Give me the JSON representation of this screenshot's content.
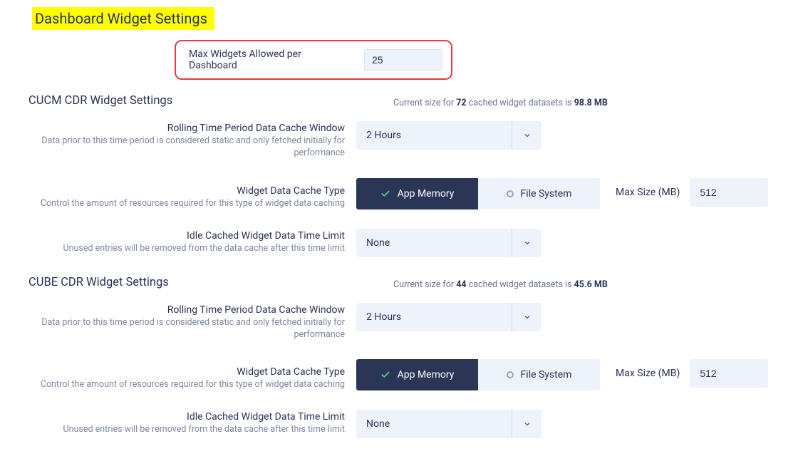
{
  "page_title": "Dashboard Widget Settings",
  "max_widgets": {
    "label": "Max Widgets Allowed per Dashboard",
    "value": "25"
  },
  "sections": {
    "cucm": {
      "title": "CUCM CDR Widget Settings",
      "cache_info_prefix": "Current size for ",
      "cache_info_count": "72",
      "cache_info_mid": " cached widget datasets is ",
      "cache_info_size": "98.8 MB",
      "rolling": {
        "label": "Rolling Time Period Data Cache Window",
        "help": "Data prior to this time period is considered static and only fetched initially for performance",
        "value": "2 Hours"
      },
      "cache_type": {
        "label": "Widget Data Cache Type",
        "help": "Control the amount of resources required for this type of widget data caching",
        "opt_active": "App Memory",
        "opt_inactive": "File System",
        "max_label": "Max Size (MB)",
        "max_value": "512"
      },
      "idle": {
        "label": "Idle Cached Widget Data Time Limit",
        "help": "Unused entries will be removed from the data cache after this time limit",
        "value": "None"
      }
    },
    "cube": {
      "title": "CUBE CDR Widget Settings",
      "cache_info_prefix": "Current size for ",
      "cache_info_count": "44",
      "cache_info_mid": " cached widget datasets is ",
      "cache_info_size": "45.6 MB",
      "rolling": {
        "label": "Rolling Time Period Data Cache Window",
        "help": "Data prior to this time period is considered static and only fetched initially for performance",
        "value": "2 Hours"
      },
      "cache_type": {
        "label": "Widget Data Cache Type",
        "help": "Control the amount of resources required for this type of widget data caching",
        "opt_active": "App Memory",
        "opt_inactive": "File System",
        "max_label": "Max Size (MB)",
        "max_value": "512"
      },
      "idle": {
        "label": "Idle Cached Widget Data Time Limit",
        "help": "Unused entries will be removed from the data cache after this time limit",
        "value": "None"
      }
    }
  }
}
